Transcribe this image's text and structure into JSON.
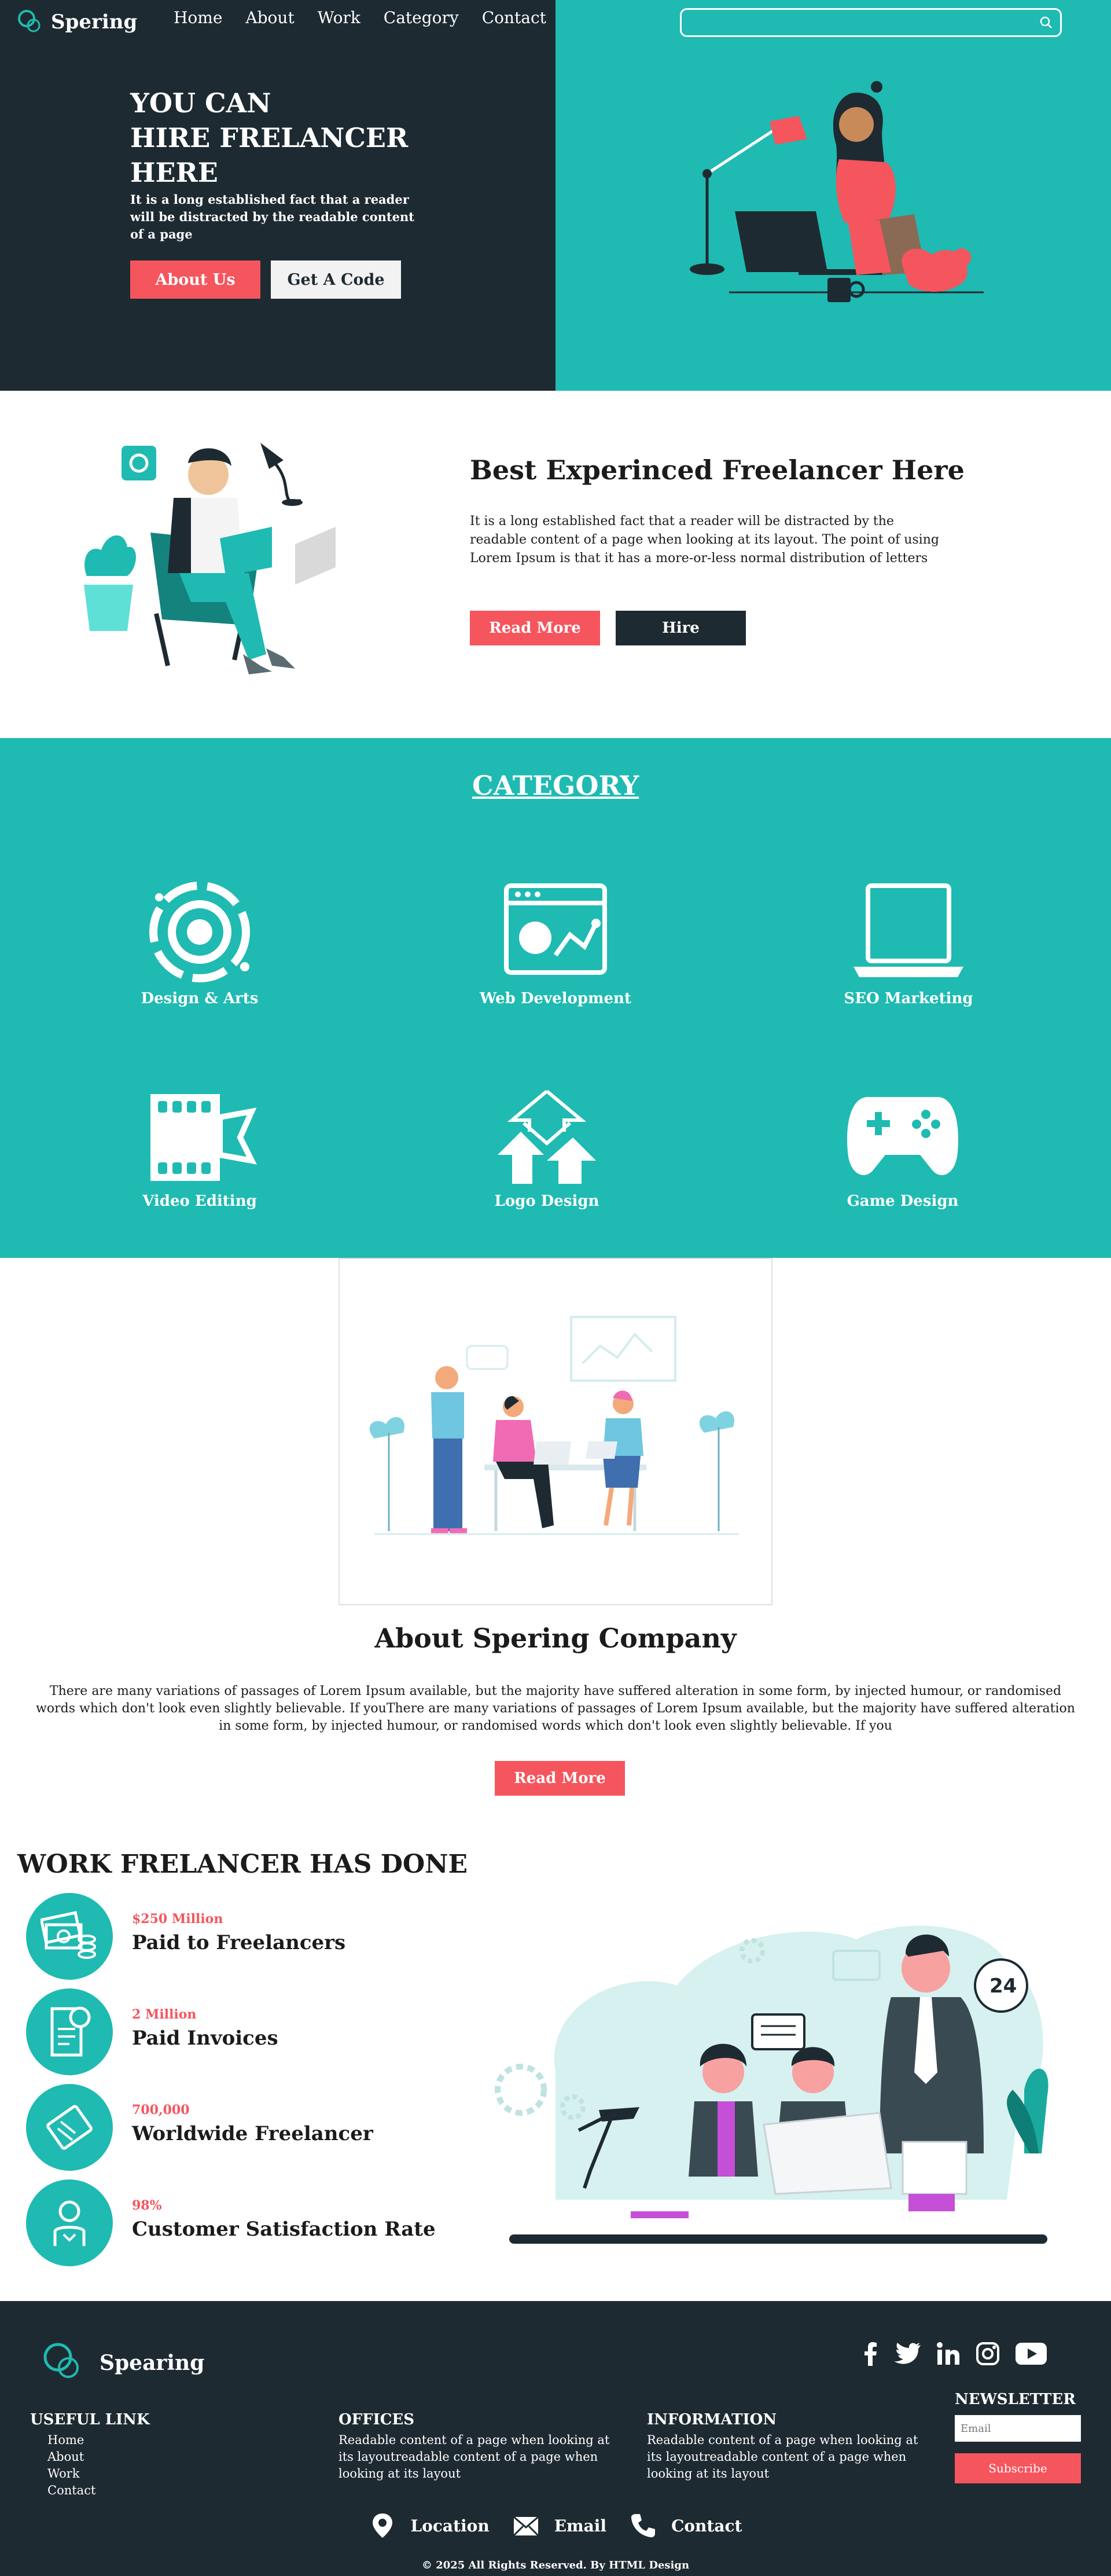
{
  "header": {
    "brand": "Spering",
    "nav": [
      "Home",
      "About",
      "Work",
      "Category",
      "Contact"
    ],
    "search_placeholder": ""
  },
  "hero": {
    "title_lines": [
      "YOU CAN",
      "HIRE FRELANCER",
      "HERE"
    ],
    "subtitle": "It is a long established fact that a reader will be distracted by the readable content of a page",
    "btn_about": "About Us",
    "btn_code": "Get A Code"
  },
  "experienced": {
    "title": "Best Experinced Freelancer Here",
    "text": "It is a long established fact that a reader will be distracted by the readable content of a page when looking at its layout. The point of using Lorem Ipsum is that it has a more-or-less normal distribution of letters",
    "btn_read": "Read More",
    "btn_hire": "Hire"
  },
  "category": {
    "title": "CATEGORY",
    "items": [
      {
        "label": "Design & Arts",
        "icon": "design-arts-icon"
      },
      {
        "label": "Web Development",
        "icon": "web-development-icon"
      },
      {
        "label": "SEO Marketing",
        "icon": "seo-marketing-icon"
      },
      {
        "label": "Video Editing",
        "icon": "video-editing-icon"
      },
      {
        "label": "Logo Design",
        "icon": "logo-design-icon"
      },
      {
        "label": "Game Design",
        "icon": "game-design-icon"
      }
    ]
  },
  "about": {
    "title": "About Spering Company",
    "text": "There are many variations of passages of Lorem Ipsum available, but the majority have suffered alteration in some form, by injected humour, or randomised words which don't look even slightly believable. If youThere are many variations of passages of Lorem Ipsum available, but the majority have suffered alteration in some form, by injected humour, or randomised words which don't look even slightly believable. If you",
    "btn_read": "Read More"
  },
  "work": {
    "title": "WORK FRELANCER HAS DONE",
    "stats": [
      {
        "value": "$250 Million",
        "label": "Paid to Freelancers",
        "icon": "money-icon"
      },
      {
        "value": "2 Million",
        "label": "Paid Invoices",
        "icon": "invoice-icon"
      },
      {
        "value": "700,000",
        "label": "Worldwide Freelancer",
        "icon": "ticket-icon"
      },
      {
        "value": "98%",
        "label": "Customer Satisfaction Rate",
        "icon": "support-person-icon"
      }
    ],
    "badge_24": "24"
  },
  "footer": {
    "brand": "Spearing",
    "useful_title": "USEFUL LINK",
    "useful_links": [
      "Home",
      "About",
      "Work",
      "Contact"
    ],
    "offices_title": "OFFICES",
    "offices_text": "Readable content of a page when looking at its layoutreadable content of a page when looking at its layout",
    "info_title": "INFORMATION",
    "info_text": "Readable content of a page when looking at its layoutreadable content of a page when looking at its layout",
    "newsletter_title": "NEWSLETTER",
    "email_placeholder": "Email",
    "subscribe": "Subscribe",
    "contact": {
      "location": "Location",
      "email": "Email",
      "contact": "Contact"
    },
    "copyright": "© 2025 All Rights Reserved. By HTML Design"
  },
  "colors": {
    "dark": "#1e2a31",
    "teal": "#1fbab2",
    "coral": "#f5555d"
  }
}
